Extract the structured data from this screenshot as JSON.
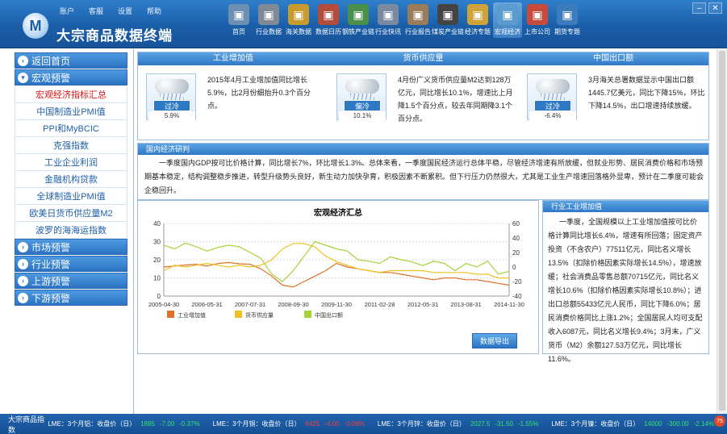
{
  "app": {
    "title": "大宗商品数据终端",
    "logo_text": "M"
  },
  "top_menu": [
    "账户",
    "客服",
    "设置",
    "帮助"
  ],
  "nav": [
    {
      "label": "首页",
      "icon": "house-icon",
      "color": "#6c8fb3"
    },
    {
      "label": "行业数据",
      "icon": "bar-chart-icon",
      "color": "#7f8a96"
    },
    {
      "label": "海关数据",
      "icon": "globe-icon",
      "color": "#c99b2d"
    },
    {
      "label": "数据日历",
      "icon": "calendar-icon",
      "color": "#b34c3a"
    },
    {
      "label": "钢铁产业链",
      "icon": "chain-icon",
      "color": "#4a8f4a"
    },
    {
      "label": "行业快讯",
      "icon": "news-icon",
      "color": "#7a8aa0"
    },
    {
      "label": "行业报告",
      "icon": "report-icon",
      "color": "#9a7b5a"
    },
    {
      "label": "煤炭产业链",
      "icon": "coal-icon",
      "color": "#444"
    },
    {
      "label": "经济专题",
      "icon": "topic-icon",
      "color": "#d0a23a"
    },
    {
      "label": "宏观经济",
      "icon": "macro-icon",
      "color": "#5b9ccf"
    },
    {
      "label": "上市公司",
      "icon": "company-icon",
      "color": "#c74b3b"
    },
    {
      "label": "期货专题",
      "icon": "futures-icon",
      "color": "#3e7bbd"
    }
  ],
  "nav_active": 9,
  "sidebar": {
    "home": "返回首页",
    "macro_group": "宏观预警",
    "macro_items": [
      "宏观经济指标汇总",
      "中国制造业PMI值",
      "PPI和MyBCIC",
      "克强指数",
      "工业企业利润",
      "金融机构贷款",
      "全球制造业PMI值",
      "欧美日货币供应量M2",
      "波罗的海海运指数"
    ],
    "active_index": 0,
    "groups": [
      "市场预警",
      "行业预警",
      "上游预警",
      "下游预警"
    ]
  },
  "indicators": {
    "headers": [
      "工业增加值",
      "货币供应量",
      "中国出口额"
    ],
    "cards": [
      {
        "weather": "过冷",
        "value": "5.9%",
        "text": "2015年4月工业增加值同比增长5.9%，比2月份细抬升0.3个百分点。"
      },
      {
        "weather": "偏冷",
        "value": "10.1%",
        "text": "4月份广义货币供应量M2达到128万亿元，同比增长10.1%，增速比上月降1.5个百分点，较去年同期降3.1个百分点。"
      },
      {
        "weather": "过冷",
        "value": "-6.4%",
        "text": "3月海关总署数据显示中国出口额1445.7亿美元，同比下降15%，环比下降14.5%，出口增速持续放缓。"
      }
    ]
  },
  "analysis": {
    "title": "国内经济研判",
    "body": "一季度国内GDP按可比价格计算，同比增长7%，环比增长1.3%。总体来看，一季度国民经济运行总体平稳，尽管经济增速有所放缓，但就业形势、居民消费价格和市场预期基本稳定，结构调整稳步推进，转型升级势头良好，新生动力加快孕育，积极因素不断累积。但下行压力仍然很大，尤其是工业生产增速回落格外显卑，预计在二季度可能会企稳回升。"
  },
  "chart_data": {
    "type": "line",
    "title": "宏观经济汇总",
    "x_ticks": [
      "2005-04-30",
      "2006-05-31",
      "2007-07-31",
      "2008-09-30",
      "2009-11-30",
      "2011-02-28",
      "2012-05-31",
      "2013-08-31",
      "2014-11-30"
    ],
    "ylim_left": [
      0,
      40
    ],
    "ylim_right": [
      -40,
      60
    ],
    "yticks_left": [
      0,
      10,
      20,
      30,
      40
    ],
    "yticks_right": [
      -40,
      -20,
      0,
      20,
      40,
      60
    ],
    "grid": true,
    "legend_position": "bottom",
    "series": [
      {
        "name": "工业增加值",
        "color": "#e07028",
        "axis": "left",
        "values": [
          16,
          16.6,
          17.1,
          17.5,
          16.5,
          17.9,
          18.5,
          17.8,
          17.5,
          15,
          11,
          6,
          5,
          8,
          11,
          14,
          18,
          16,
          15,
          14,
          13,
          13,
          12,
          11,
          10,
          9,
          10,
          10,
          9,
          9,
          8,
          7,
          6
        ]
      },
      {
        "name": "货币供应量",
        "color": "#f0c020",
        "axis": "left",
        "values": [
          14,
          17,
          16,
          17,
          18,
          17,
          16,
          17,
          16,
          17,
          20,
          26,
          29,
          29,
          27,
          22,
          19,
          17,
          15,
          14,
          13,
          14,
          14,
          14,
          14,
          13,
          13,
          13,
          13,
          12,
          12,
          10,
          10
        ]
      },
      {
        "name": "中国出口额",
        "color": "#a6d23a",
        "axis": "right",
        "values": [
          30,
          25,
          33,
          28,
          22,
          27,
          30,
          28,
          20,
          12,
          -10,
          -20,
          -5,
          15,
          35,
          30,
          25,
          22,
          10,
          8,
          5,
          14,
          10,
          7,
          2,
          8,
          5,
          -5,
          5,
          0,
          8,
          -10,
          -6
        ]
      }
    ]
  },
  "export_button": "数据导出",
  "industry": {
    "title": "行业工业增加值",
    "body": "一季度，全国规模以上工业增加值按可比价格计算同比增长6.4%，增速有所回落；固定资产投资（不含农户）77511亿元，同比名义增长13.5%（扣除价格因素实际增长14.5%），增速放缓；社会消费品零售总额70715亿元，同比名义增长10.6%（扣除价格因素实际增长10.8%）；进出口总额55433亿元人民币，同比下降6.0%；居民消费价格同比上涨1.2%；全国居民人均可支配收入6087元，同比名义增长9.4%；3月末，广义货币（M2）余额127.53万亿元，同比增长11.6%。"
  },
  "footer": {
    "title": "大宗商品指数",
    "tickers": [
      {
        "label": "LME：3个月铝：收盘价（日）",
        "value": "1885",
        "change": "-7.00",
        "pct": "-0.37%",
        "dir": "up"
      },
      {
        "label": "LME：3个月铜：收盘价（日）",
        "value": "6425",
        "change": "-4.00",
        "pct": "-0.06%",
        "dir": "down"
      },
      {
        "label": "LME：3个月锌：收盘价（日）",
        "value": "2027.5",
        "change": "-31.50",
        "pct": "-1.55%",
        "dir": "up"
      },
      {
        "label": "LME：3个月镍：收盘价（日）",
        "value": "14000",
        "change": "-300.00",
        "pct": "-2.14%",
        "dir": "up"
      }
    ]
  }
}
